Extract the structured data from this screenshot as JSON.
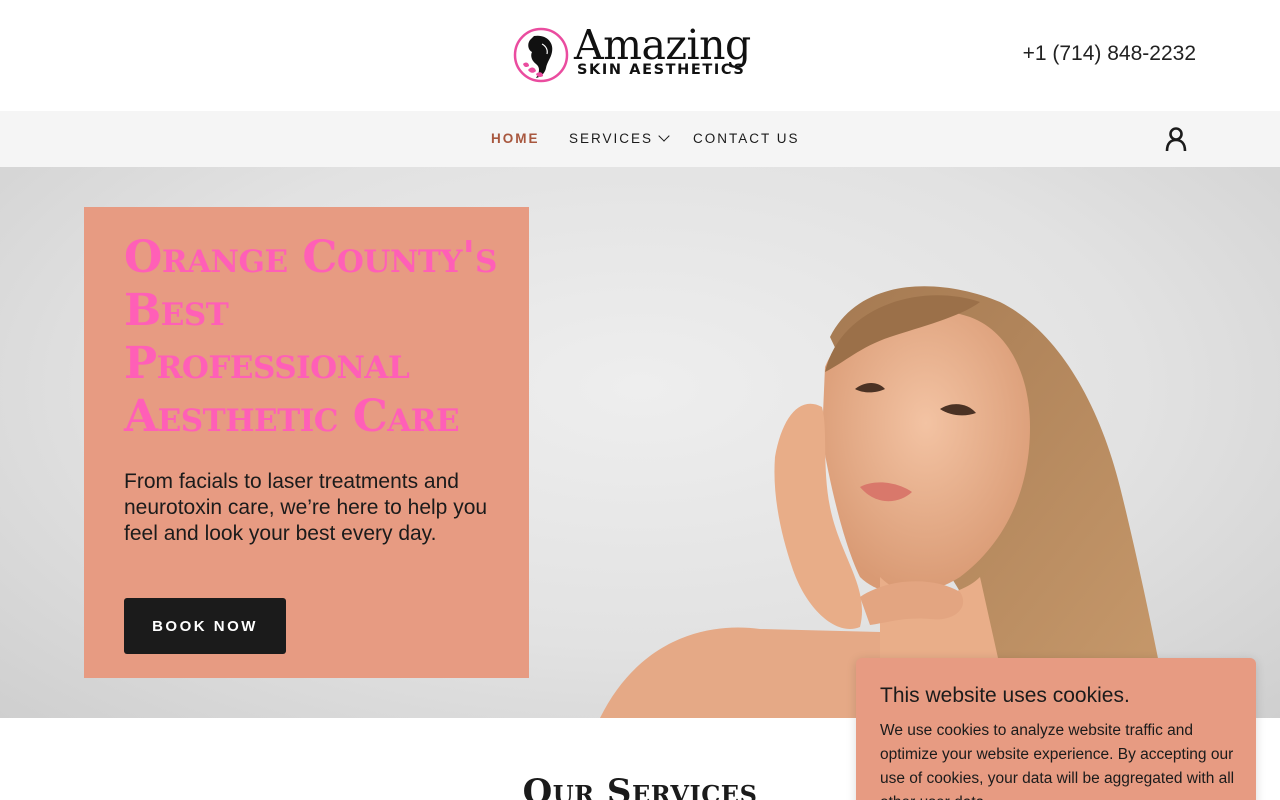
{
  "header": {
    "logo": {
      "word": "Amazing",
      "subtitle": "SKIN AESTHETICS"
    },
    "phone": "+1 (714) 848-2232"
  },
  "nav": {
    "items": [
      {
        "label": "HOME",
        "active": true
      },
      {
        "label": "SERVICES",
        "has_dropdown": true
      },
      {
        "label": "CONTACT US"
      }
    ],
    "account_icon": "user-icon"
  },
  "hero": {
    "title": "Orange County's Best Professional Aesthetic Care",
    "text": "From facials to laser treatments and neurotoxin care, we’re here to help you feel and look your best every day.",
    "button": "BOOK NOW"
  },
  "services": {
    "heading": "Our Services"
  },
  "cookie": {
    "title": "This website uses cookies.",
    "body": "We use cookies to analyze website traffic and optimize your website experience. By accepting our use of cookies, your data will be aggregated with all other user data."
  },
  "colors": {
    "accent_pink": "#ff5fb7",
    "card_salmon": "#e79b82",
    "nav_active": "#a8573e",
    "button_dark": "#1b1b1b"
  }
}
